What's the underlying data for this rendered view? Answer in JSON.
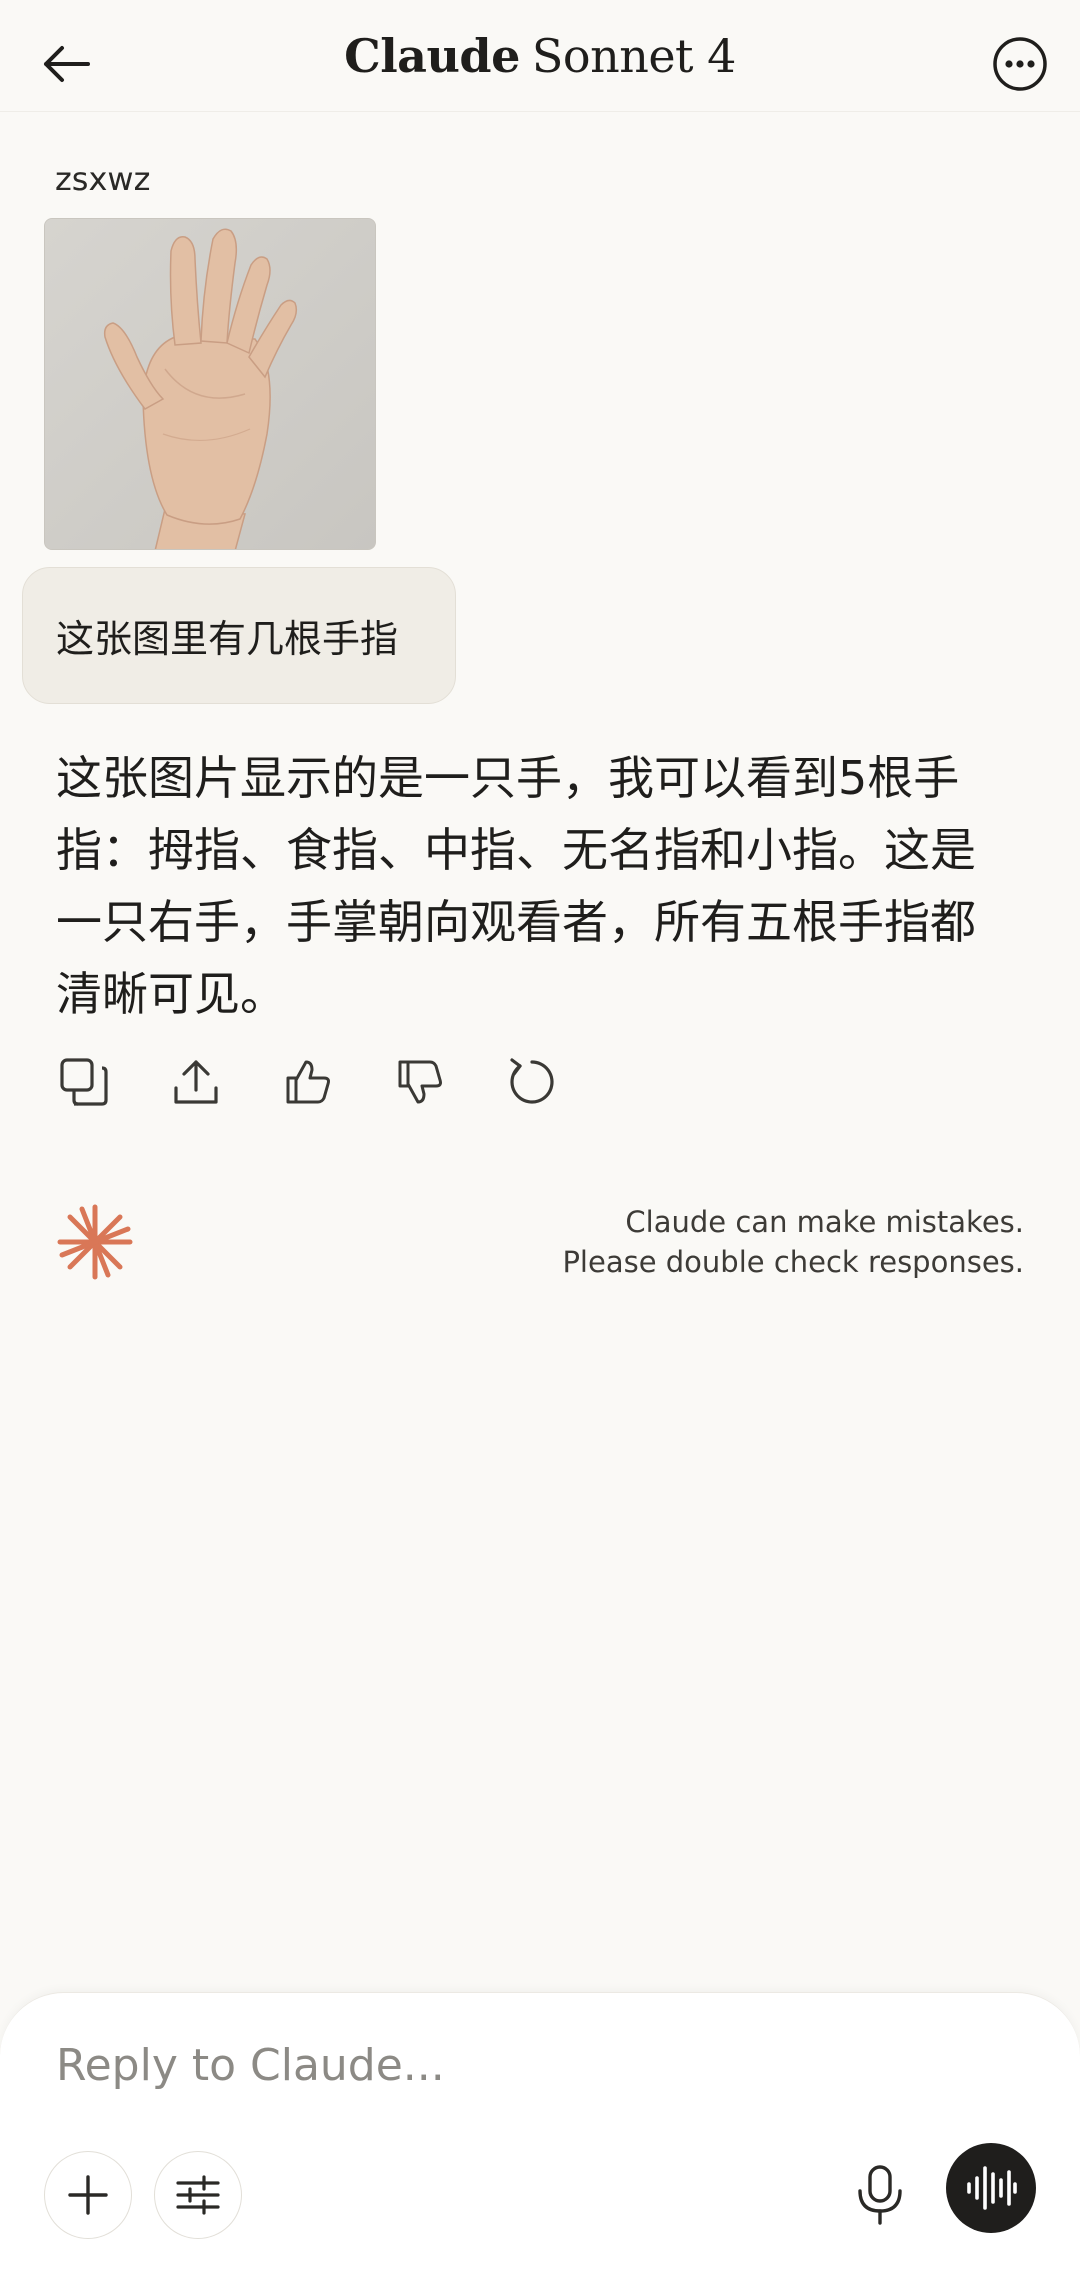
{
  "header": {
    "title_strong": "Claude",
    "title_rest": "Sonnet 4",
    "icons": {
      "back": "arrow-left-icon",
      "more": "more-horizontal-icon"
    }
  },
  "conversation": {
    "user": {
      "name": "zsxwz",
      "attachment_icon": "hand-photo",
      "message": "这张图里有几根手指"
    },
    "assistant": {
      "response": "这张图片显示的是一只手，我可以看到5根手指：拇指、食指、中指、无名指和小指。这是一只右手，手掌朝向观看者，所有五根手指都清晰可见。",
      "actions": [
        "copy-icon",
        "share-icon",
        "thumbs-up-icon",
        "thumbs-down-icon",
        "retry-icon"
      ]
    }
  },
  "footer_note": {
    "line1": "Claude can make mistakes.",
    "line2": "Please double check responses.",
    "logo_color": "#D97757"
  },
  "composer": {
    "placeholder": "Reply to Claude...",
    "icons": [
      "plus-icon",
      "sliders-icon",
      "microphone-icon",
      "voice-waveform-icon"
    ]
  }
}
